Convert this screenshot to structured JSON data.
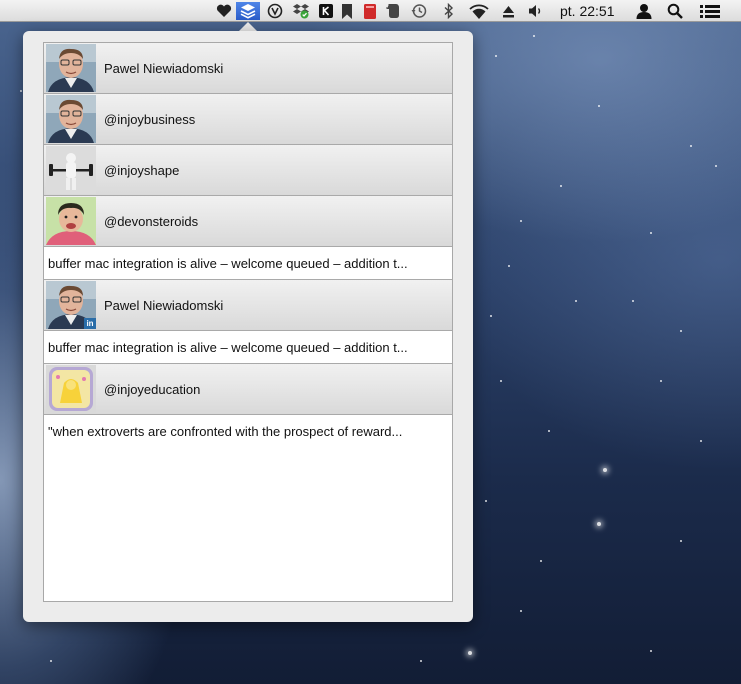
{
  "menubar": {
    "clock": "pt. 22:51",
    "icons": [
      "heart-icon",
      "buffer-icon",
      "sonos-icon",
      "dropbox-icon",
      "kindle-icon",
      "bookmark-icon",
      "red-book-icon",
      "evernote-icon",
      "time-machine-icon",
      "bluetooth-icon",
      "wifi-icon",
      "eject-icon",
      "volume-icon",
      "user-icon",
      "spotlight-icon",
      "notification-center-icon"
    ]
  },
  "accounts": [
    {
      "name": "Pawel Niewiadomski"
    },
    {
      "name": "@injoybusiness"
    },
    {
      "name": "@injoyshape"
    },
    {
      "name": "@devonsteroids",
      "preview": "buffer mac integration is alive – welcome queued – addition t..."
    },
    {
      "name": "Pawel Niewiadomski",
      "network": "in",
      "preview": "buffer mac integration is alive – welcome queued – addition t..."
    },
    {
      "name": "@injoyeducation",
      "preview": "\"when extroverts are confronted with the prospect of reward..."
    }
  ],
  "colors": {
    "highlight": "#3b6fd8",
    "popover_bg": "#ececec",
    "row_border": "#a9a9a9"
  }
}
